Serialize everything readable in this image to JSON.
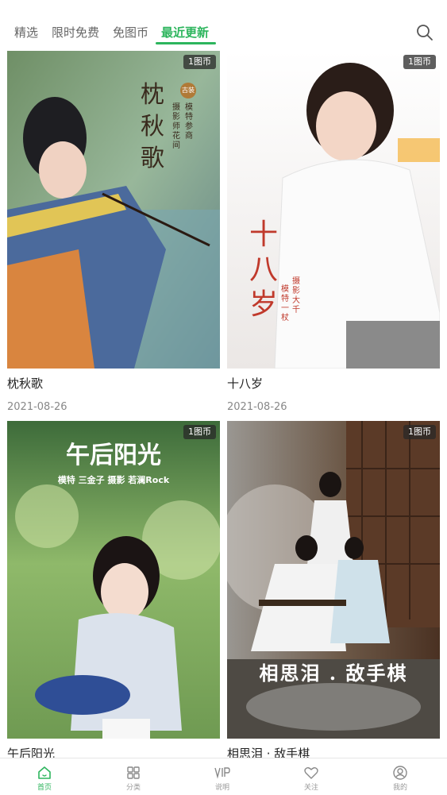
{
  "tabs": [
    {
      "label": "精选",
      "active": false
    },
    {
      "label": "限时免费",
      "active": false
    },
    {
      "label": "免图币",
      "active": false
    },
    {
      "label": "最近更新",
      "active": true
    }
  ],
  "search_icon": "search-icon",
  "cards": [
    {
      "title": "枕秋歌",
      "date": "2021-08-26",
      "badge": "1图币",
      "poster_title": "枕秋歌",
      "poster_tag": "古装",
      "poster_credit_model": "模特 参商",
      "poster_credit_photo": "摄影师 花间"
    },
    {
      "title": "十八岁",
      "date": "2021-08-26",
      "badge": "1图币",
      "poster_title": "十八岁",
      "poster_credit_photo": "摄影 大千",
      "poster_credit_model": "模特 一杖"
    },
    {
      "title": "午后阳光",
      "date": "",
      "badge": "1图币",
      "poster_title": "午后阳光",
      "poster_credit": "模特 三金子   摄影 若澜Rock"
    },
    {
      "title": "相思泪 · 敌手棋",
      "date": "",
      "badge": "1图币",
      "poster_title": "相思泪 . 敌手棋"
    }
  ],
  "bottom_nav": [
    {
      "label": "首页",
      "icon": "home-icon",
      "active": true
    },
    {
      "label": "分类",
      "icon": "grid-icon",
      "active": false
    },
    {
      "label": "说明",
      "icon": "vip-icon",
      "active": false
    },
    {
      "label": "关注",
      "icon": "heart-icon",
      "active": false
    },
    {
      "label": "我的",
      "icon": "profile-icon",
      "active": false
    }
  ],
  "colors": {
    "accent": "#2db55d",
    "text": "#222222",
    "muted": "#888888"
  }
}
